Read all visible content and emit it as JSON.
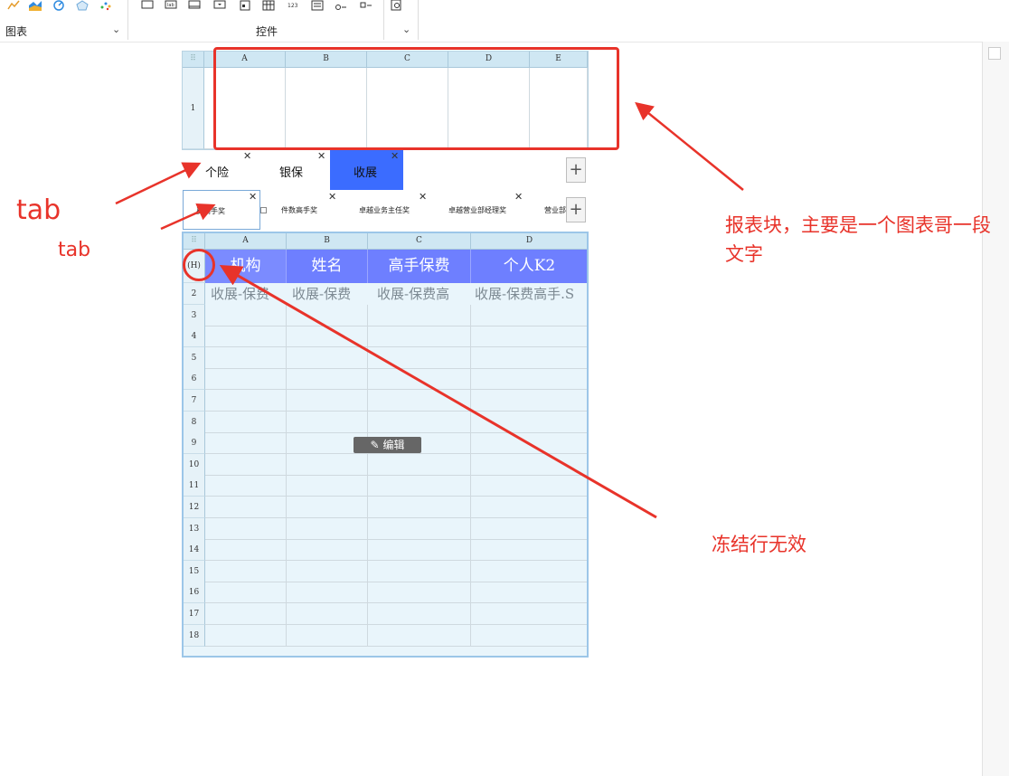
{
  "toolbar": {
    "group_chart_label": "图表",
    "group_controls_label": "控件"
  },
  "top_sheet": {
    "columns": [
      "A",
      "B",
      "C",
      "D",
      "E"
    ],
    "rows": [
      "1"
    ]
  },
  "tabs": {
    "primary": [
      "个险",
      "银保",
      "收展"
    ],
    "secondary": [
      "费高手奖",
      "件数高手奖",
      "卓越业务主任奖",
      "卓越营业部经理奖",
      "营业部"
    ]
  },
  "main_sheet": {
    "columns": [
      "A",
      "B",
      "C",
      "D"
    ],
    "header_row_label": "(H)",
    "header_cells": [
      "机构",
      "姓名",
      "高手保费",
      "个人K2"
    ],
    "data_row": [
      "收展-保费",
      "收展-保费",
      "收展-保费高",
      "收展-保费高手.S"
    ],
    "row_numbers": [
      "2",
      "3",
      "4",
      "5",
      "6",
      "7",
      "8",
      "9",
      "10",
      "11",
      "12",
      "13",
      "14",
      "15",
      "16",
      "17",
      "18"
    ],
    "edit_button": "编辑"
  },
  "annotations": {
    "tab1": "tab",
    "tab2": "tab",
    "report_block": "报表块，主要是一个图表哥一段文字",
    "freeze_invalid": "冻结行无效"
  },
  "colors": {
    "accent_tab": "#3b6cff",
    "header_fill": "#6e7fff",
    "annotation_red": "#e8332a"
  }
}
